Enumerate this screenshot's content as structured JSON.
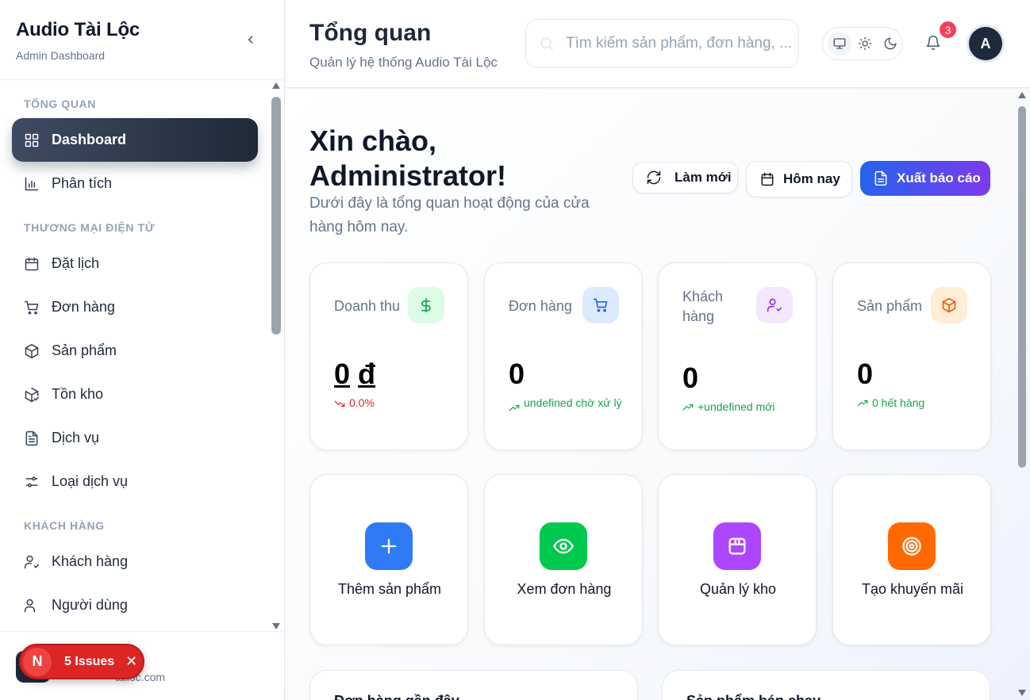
{
  "sidebar": {
    "brand_title": "Audio Tài Lộc",
    "brand_sub": "Admin Dashboard",
    "sections": {
      "overview": "TỔNG QUAN",
      "ecommerce": "THƯƠNG MẠI ĐIỆN TỬ",
      "customers": "KHÁCH HÀNG"
    },
    "items": {
      "dashboard": "Dashboard",
      "analytics": "Phân tích",
      "booking": "Đặt lịch",
      "orders": "Đơn hàng",
      "products": "Sản phẩm",
      "inventory": "Tồn kho",
      "services": "Dịch vụ",
      "service_types": "Loại dịch vụ",
      "customers": "Khách hàng",
      "users": "Người dùng"
    },
    "footer_email": "tailoc.com"
  },
  "issues": {
    "letter": "N",
    "label": "5 Issues",
    "close": "✕"
  },
  "header": {
    "title": "Tổng quan",
    "subtitle": "Quản lý hệ thống Audio Tài Lộc",
    "search_placeholder": "Tìm kiếm sản phẩm, đơn hàng, ...",
    "notification_count": "3",
    "avatar_letter": "A"
  },
  "main": {
    "greeting": "Xin chào, Administrator!",
    "greeting_sub": "Dưới đây là tổng quan hoạt động của cửa hàng hôm nay.",
    "buttons": {
      "refresh": "Làm mới",
      "today": "Hôm nay",
      "export": "Xuất báo cáo"
    },
    "stats": {
      "revenue": {
        "label": "Doanh thu",
        "value": "0",
        "currency": "đ",
        "trend": "0.0%"
      },
      "orders": {
        "label": "Đơn hàng",
        "value": "0",
        "trend": "undefined chờ xử lý"
      },
      "customers": {
        "label": "Khách hàng",
        "value": "0",
        "trend": "+undefined mới"
      },
      "products": {
        "label": "Sản phẩm",
        "value": "0",
        "trend": "0 hết hàng"
      }
    },
    "actions": {
      "add_product": "Thêm sản phẩm",
      "view_orders": "Xem đơn hàng",
      "manage_inventory": "Quản lý kho",
      "create_promo": "Tạo khuyến mãi"
    },
    "panels": {
      "left": "Đơn hàng gần đây",
      "right": "Sản phẩm bán chạy"
    }
  },
  "colors": {
    "accent_gradient_start": "#2563eb",
    "accent_gradient_end": "#7c3aed",
    "active_nav": "#2d3748",
    "badge": "#f43f5e",
    "issues": "#dc2626"
  }
}
